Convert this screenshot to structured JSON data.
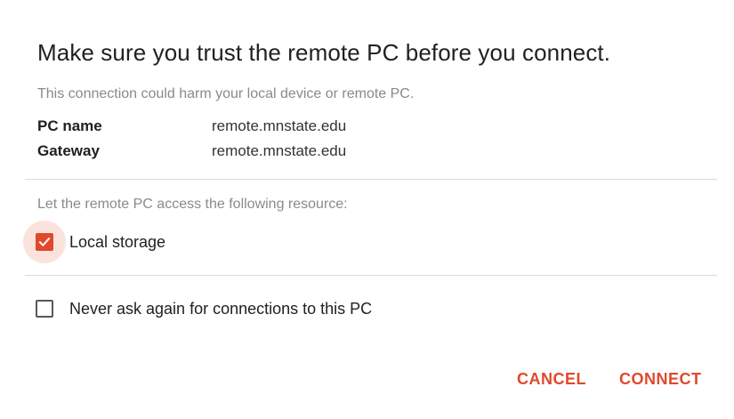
{
  "dialog": {
    "title": "Make sure you trust the remote PC before you connect.",
    "warning": "This connection could harm your local device or remote PC.",
    "info": [
      {
        "key": "PC name",
        "value": "remote.mnstate.edu"
      },
      {
        "key": "Gateway",
        "value": "remote.mnstate.edu"
      }
    ],
    "resource_intro": "Let the remote PC access the following resource:",
    "resources": [
      {
        "label": "Local storage",
        "checked": true
      }
    ],
    "never_ask": {
      "label": "Never ask again for connections to this PC",
      "checked": false
    },
    "buttons": {
      "cancel": "CANCEL",
      "connect": "CONNECT"
    },
    "accent_color": "#e0492b"
  }
}
